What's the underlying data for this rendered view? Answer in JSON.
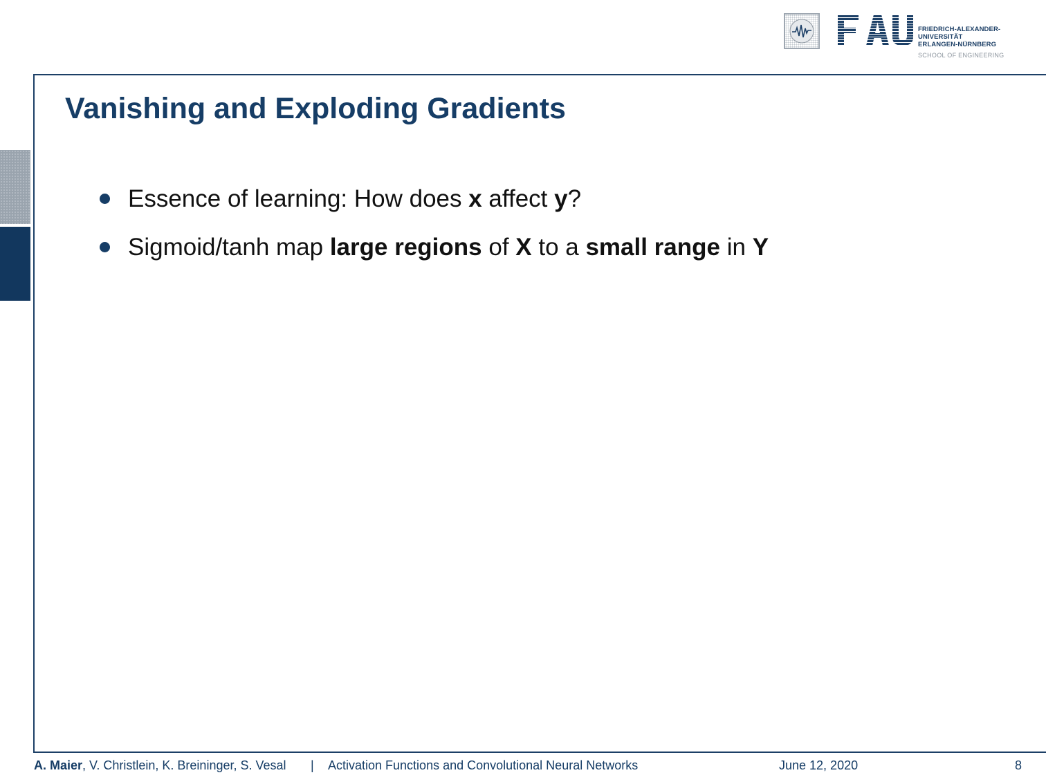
{
  "header": {
    "logo_main": "FAU",
    "logo_lines": [
      "FRIEDRICH-ALEXANDER-",
      "UNIVERSITÄT",
      "ERLANGEN-NÜRNBERG"
    ],
    "logo_school": "SCHOOL OF ENGINEERING",
    "seal_icon": "fau-seal-icon",
    "brand_color": "#1c3f66",
    "side_tab_colors": [
      "#9aa4ae",
      "#12375e"
    ]
  },
  "slide": {
    "title": "Vanishing and Exploding Gradients",
    "bullets": [
      {
        "parts": [
          {
            "text": "Essence of learning: How does ",
            "bold": false
          },
          {
            "text": "x",
            "bold": true
          },
          {
            "text": " affect ",
            "bold": false
          },
          {
            "text": "y",
            "bold": true
          },
          {
            "text": "?",
            "bold": false
          }
        ]
      },
      {
        "parts": [
          {
            "text": "Sigmoid/tanh map ",
            "bold": false
          },
          {
            "text": "large regions",
            "bold": true
          },
          {
            "text": " of ",
            "bold": false
          },
          {
            "text": "X",
            "bold": true
          },
          {
            "text": " to a ",
            "bold": false
          },
          {
            "text": "small range",
            "bold": true
          },
          {
            "text": " in ",
            "bold": false
          },
          {
            "text": "Y",
            "bold": true
          }
        ]
      }
    ]
  },
  "footer": {
    "lead_author": "A. Maier",
    "other_authors": ", V. Christlein, K. Breininger, S. Vesal",
    "separator": "|",
    "course": "Activation Functions and Convolutional Neural Networks",
    "date": "June 12, 2020",
    "page": "8"
  }
}
